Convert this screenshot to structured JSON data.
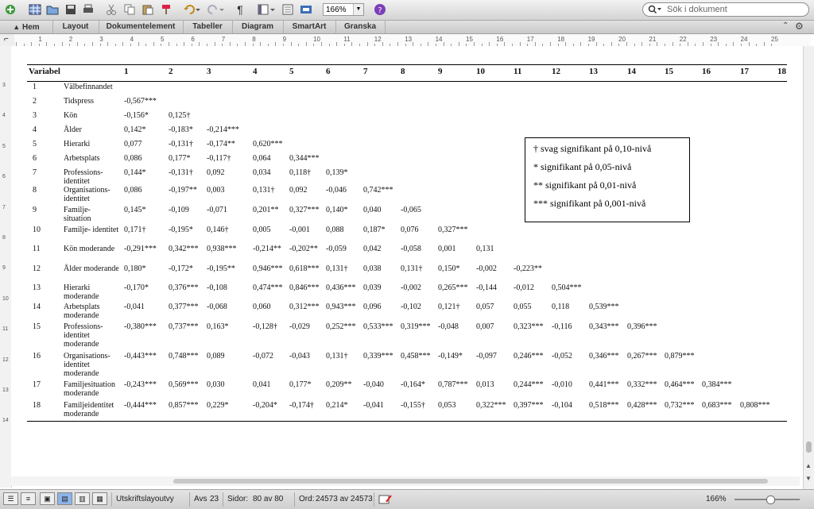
{
  "toolbar": {
    "zoom": "166%",
    "search_placeholder": "Sök i dokument",
    "pilcrow": "¶"
  },
  "ribbon": {
    "tabs": [
      "Hem",
      "Layout",
      "Dokumentelement",
      "Tabeller",
      "Diagram",
      "SmartArt",
      "Granska"
    ]
  },
  "ruler": {
    "ticks": [
      "1",
      "2",
      "3",
      "4",
      "5",
      "6",
      "7",
      "8",
      "9",
      "10",
      "11",
      "12",
      "13",
      "14",
      "15",
      "16",
      "17",
      "18",
      "19",
      "20",
      "21",
      "22",
      "23",
      "24",
      "25"
    ]
  },
  "vruler": {
    "ticks": [
      "3",
      "4",
      "5",
      "6",
      "7",
      "8",
      "9",
      "10",
      "11",
      "12",
      "13",
      "14"
    ]
  },
  "table": {
    "header_label": "Variabel",
    "col_headers": [
      "1",
      "2",
      "3",
      "4",
      "5",
      "6",
      "7",
      "8",
      "9",
      "10",
      "11",
      "12",
      "13",
      "14",
      "15",
      "16",
      "17",
      "18"
    ],
    "rows": [
      {
        "n": "1",
        "label": "Välbefinnandet",
        "vals": []
      },
      {
        "n": "2",
        "label": "Tidspress",
        "vals": [
          "-0,567***"
        ]
      },
      {
        "n": "3",
        "label": "Kön",
        "vals": [
          "-0,156*",
          "0,125†"
        ]
      },
      {
        "n": "4",
        "label": "Ålder",
        "vals": [
          "0,142*",
          "-0,183*",
          "-0,214***"
        ]
      },
      {
        "n": "5",
        "label": "Hierarki",
        "vals": [
          "0,077",
          "-0,131†",
          "-0,174**",
          "0,620***"
        ]
      },
      {
        "n": "6",
        "label": "Arbetsplats",
        "vals": [
          "0,086",
          "0,177*",
          "-0,117†",
          "0,064",
          "0,344***"
        ]
      },
      {
        "n": "7",
        "label": "Professions- identitet",
        "vals": [
          "0,144*",
          "-0,131†",
          "0,092",
          "0,034",
          "0,118†",
          "0,139*"
        ]
      },
      {
        "n": "8",
        "label": "Organisations- identitet",
        "vals": [
          "0,086",
          "-0,197**",
          "0,003",
          "0,131†",
          "0,092",
          "-0,046",
          "0,742***"
        ]
      },
      {
        "n": "9",
        "label": "Familje- situation",
        "vals": [
          "0,145*",
          "-0,109",
          "-0,071",
          "0,201**",
          "0,327***",
          "0,140*",
          "0,040",
          "-0,065"
        ]
      },
      {
        "n": "10",
        "label": "Familje- identitet",
        "vals": [
          "0,171†",
          "-0,195*",
          "0,146†",
          "0,005",
          "-0,001",
          "0,088",
          "0,187*",
          "0,076",
          "0,327***"
        ]
      },
      {
        "n": "11",
        "label": "Kön moderande",
        "vals": [
          "-0,291***",
          "0,342***",
          "0,938***",
          "-0,214**",
          "-0,202**",
          "-0,059",
          "0,042",
          "-0,058",
          "0,001",
          "0,131"
        ]
      },
      {
        "n": "12",
        "label": "Ålder moderande",
        "vals": [
          "0,180*",
          "-0,172*",
          "-0,195**",
          "0,946***",
          "0,618***",
          "0,131†",
          "0,038",
          "0,131†",
          "0,150*",
          "-0,002",
          "-0,223**"
        ]
      },
      {
        "n": "13",
        "label": "Hierarki moderande",
        "vals": [
          "-0,170*",
          "0,376***",
          "-0,108",
          "0,474***",
          "0,846***",
          "0,436***",
          "0,039",
          "-0,002",
          "0,265***",
          "-0,144",
          "-0,012",
          "0,504***"
        ]
      },
      {
        "n": "14",
        "label": "Arbetsplats moderande",
        "vals": [
          "-0,041",
          "0,377***",
          "-0,068",
          "0,060",
          "0,312***",
          "0,943***",
          "0,096",
          "-0,102",
          "0,121†",
          "0,057",
          "0,055",
          "0,118",
          "0,539***"
        ]
      },
      {
        "n": "15",
        "label": "Professions- identitet moderande",
        "vals": [
          "-0,380***",
          "0,737***",
          "0,163*",
          "-0,128†",
          "-0,029",
          "0,252***",
          "0,533***",
          "0,319***",
          "-0,048",
          "0,007",
          "0,323***",
          "-0,116",
          "0,343***",
          "0,396***"
        ]
      },
      {
        "n": "16",
        "label": "Organisations- identitet moderande",
        "vals": [
          "-0,443***",
          "0,748***",
          "0,089",
          "-0,072",
          "-0,043",
          "0,131†",
          "0,339***",
          "0,458***",
          "-0,149*",
          "-0,097",
          "0,246***",
          "-0,052",
          "0,346***",
          "0,267***",
          "0,879***"
        ]
      },
      {
        "n": "17",
        "label": "Familjesituation moderande",
        "vals": [
          "-0,243***",
          "0,569***",
          "0,030",
          "0,041",
          "0,177*",
          "0,209**",
          "-0,040",
          "-0,164*",
          "0,787***",
          "0,013",
          "0,244***",
          "-0,010",
          "0,441***",
          "0,332***",
          "0,464***",
          "0,384***"
        ]
      },
      {
        "n": "18",
        "label": "Familjeidentitet moderande",
        "vals": [
          "-0,444***",
          "0,857***",
          "0,229*",
          "-0,204*",
          "-0,174†",
          "0,214*",
          "-0,041",
          "-0,155†",
          "0,053",
          "0,322***",
          "0,397***",
          "-0,104",
          "0,518***",
          "0,428***",
          "0,732***",
          "0,683***",
          "0,808***"
        ]
      }
    ]
  },
  "legend": [
    "† svag signifikant på 0,10-nivå",
    "* signifikant på 0,05-nivå",
    "** signifikant på 0,01-nivå",
    "*** signifikant på 0,001-nivå"
  ],
  "status": {
    "view": "Utskriftslayoutvy",
    "avs_label": "Avs",
    "avs_value": "23",
    "sidor_label": "Sidor:",
    "sidor_value": "80 av 80",
    "ord_label": "Ord:",
    "ord_value": "24573 av 24573",
    "zoom": "166%"
  }
}
